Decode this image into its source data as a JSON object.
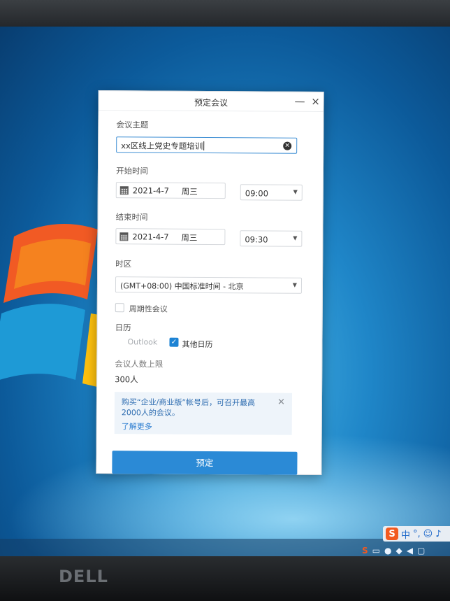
{
  "dialog": {
    "title": "预定会议",
    "minimize_glyph": "—",
    "close_glyph": "×",
    "subject": {
      "label": "会议主题",
      "value": "xx区线上党史专题培训"
    },
    "start": {
      "label": "开始时间",
      "date": "2021-4-7",
      "weekday": "周三",
      "time": "09:00"
    },
    "end": {
      "label": "结束时间",
      "date": "2021-4-7",
      "weekday": "周三",
      "time": "09:30"
    },
    "timezone": {
      "label": "时区",
      "value": "(GMT+08:00) 中国标准时间 - 北京"
    },
    "recurring": {
      "label": "周期性会议",
      "checked": false
    },
    "calendar": {
      "label": "日历",
      "options": [
        {
          "label": "Outlook",
          "checked": false,
          "disabled": true
        },
        {
          "label": "其他日历",
          "checked": true
        }
      ]
    },
    "limit": {
      "label": "会议人数上限",
      "value": "300人"
    },
    "notice": {
      "message": "购买“企业/商业版”帐号后，可召开最高2000人的会议。",
      "link": "了解更多"
    },
    "submit_label": "预定"
  },
  "taskbar": {
    "ime": {
      "logo": "S",
      "mode": "中"
    },
    "tray_icons": [
      "sogou-icon",
      "network-icon",
      "wechat-icon",
      "shield-icon",
      "volume-icon",
      "action-center-icon"
    ]
  },
  "monitor": {
    "brand": "DELL"
  },
  "colors": {
    "accent": "#2b8ad6",
    "notice_bg": "#eef4fa",
    "link": "#2f7fd1"
  }
}
